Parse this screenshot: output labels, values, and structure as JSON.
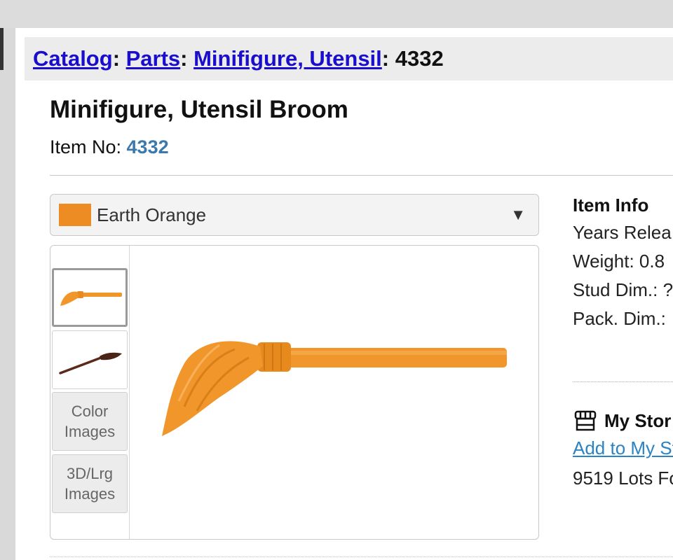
{
  "breadcrumb": {
    "items": [
      "Catalog",
      "Parts",
      "Minifigure, Utensil"
    ],
    "current": "4332"
  },
  "item": {
    "title": "Minifigure, Utensil Broom",
    "item_no_label": "Item No: ",
    "item_no": "4332"
  },
  "color_select": {
    "selected": "Earth Orange",
    "swatch_color": "#ed8c22"
  },
  "thumbnails": {
    "color_images_label": "Color Images",
    "lrg_images_label": "3D/Lrg Images"
  },
  "item_info": {
    "title": "Item Info",
    "years_released": "Years Relea",
    "weight": "Weight: 0.8",
    "stud_dim": "Stud Dim.: ?",
    "pack_dim": "Pack. Dim.:"
  },
  "store": {
    "title": "My Stor",
    "add_link": "Add to My St",
    "lots": "9519 Lots Fo"
  },
  "colors": {
    "broom_orange": "#f0962b",
    "link_blue": "#1a0dcc"
  }
}
